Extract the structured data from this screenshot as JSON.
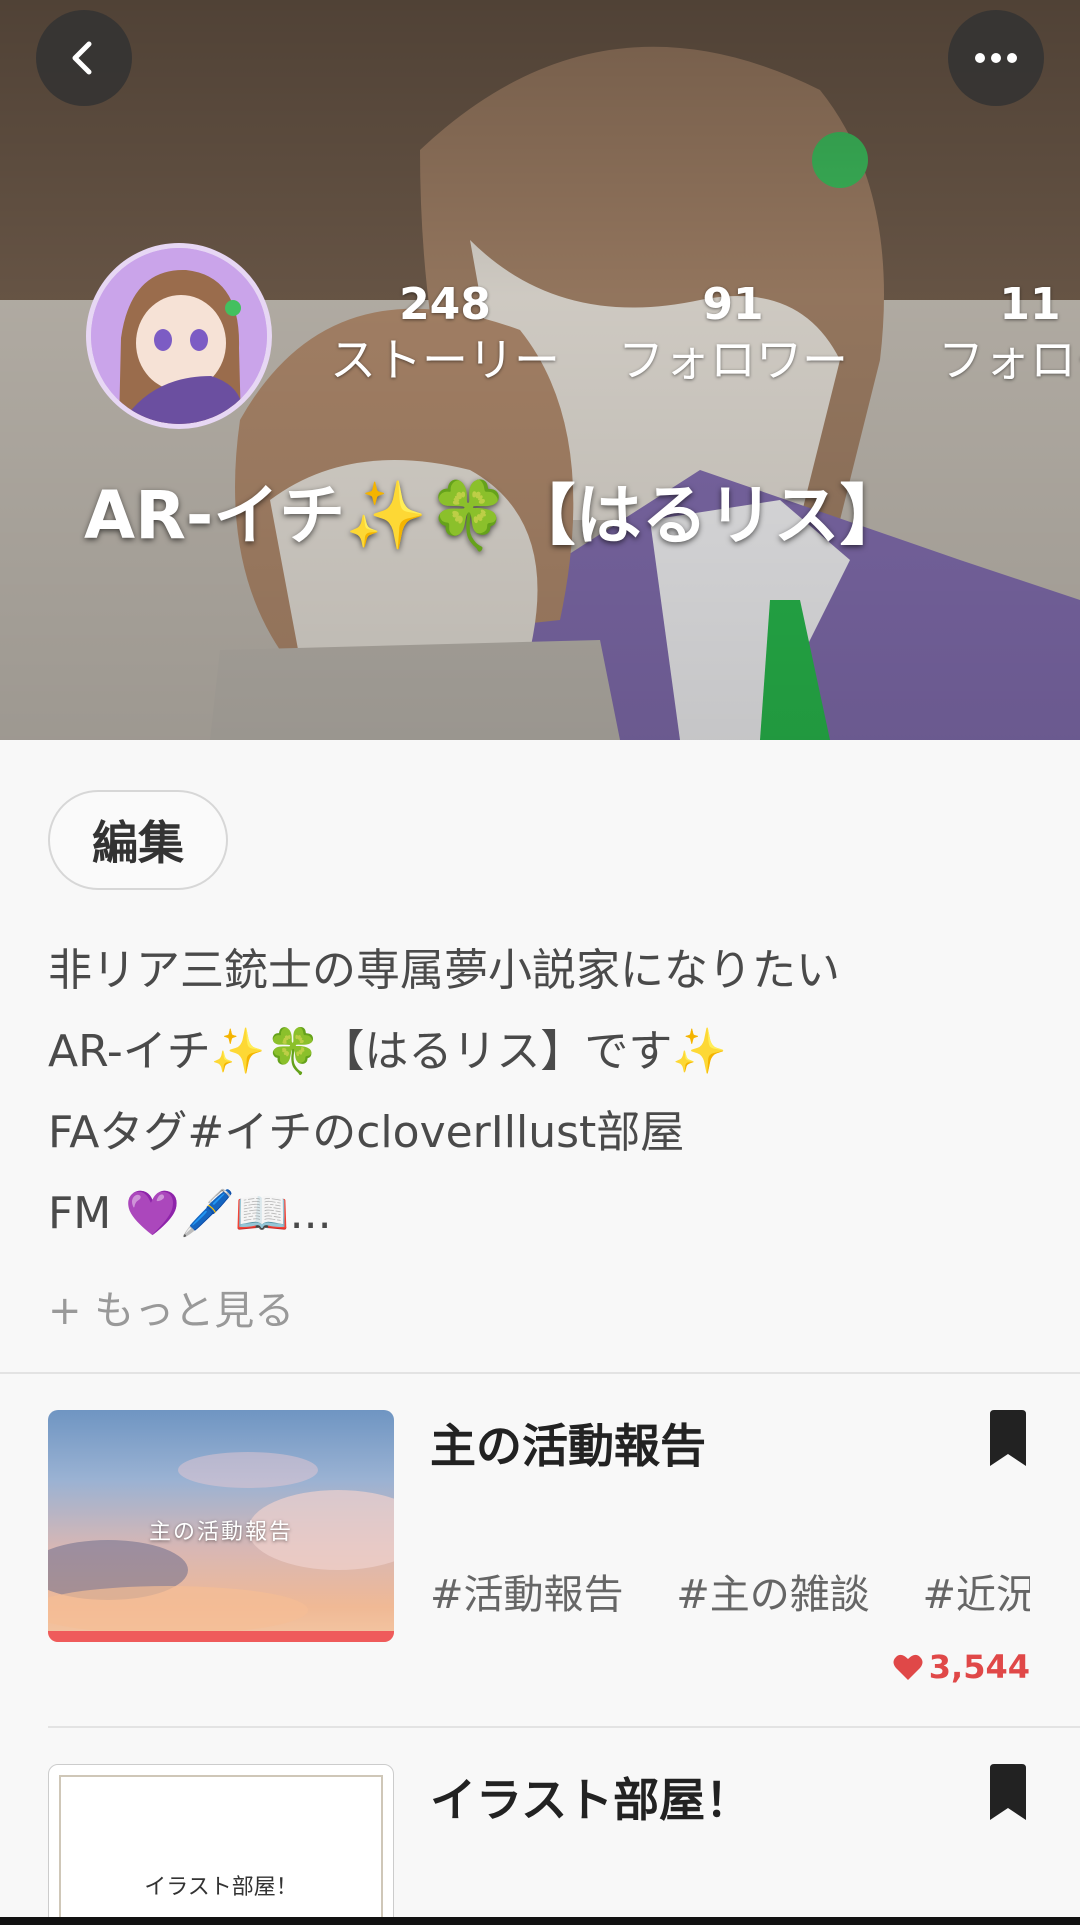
{
  "header": {
    "back_icon": "chevron-left-icon",
    "more_icon": "more-horizontal-icon",
    "profile_name": "AR-イチ✨🍀【はるリス】",
    "stats": [
      {
        "value": "248",
        "label": "ストーリー"
      },
      {
        "value": "91",
        "label": "フォロワー"
      },
      {
        "value": "11",
        "label": "フォロー"
      }
    ]
  },
  "profile": {
    "edit_label": "編集",
    "bio_lines": [
      "非リア三銃士の専属夢小説家になりたい",
      "AR-イチ✨🍀【はるリス】です✨",
      "FAタグ#イチのcloverIllust部屋",
      "FM 💜🖊️📖..."
    ],
    "show_more": "+ もっと見る"
  },
  "stories": [
    {
      "title": "主の活動報告",
      "thumb_text": "主の活動報告",
      "tags": [
        "#活動報告",
        "#主の雑談",
        "#近況..."
      ],
      "likes": "3,544"
    },
    {
      "title": "イラスト部屋！",
      "thumb_text": "イラスト部屋！"
    }
  ],
  "colors": {
    "accent": "#e04848",
    "progress_bar": "#ef5b5b"
  }
}
